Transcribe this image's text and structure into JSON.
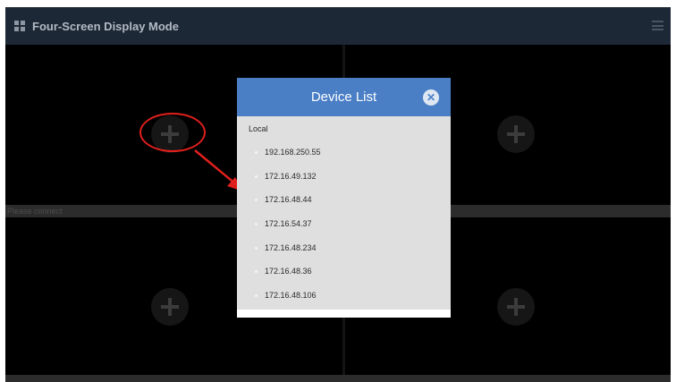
{
  "titlebar": {
    "title": "Four-Screen Display Mode",
    "grid_icon": "grid-icon",
    "menu_icon": "hamburger-menu-icon",
    "background": "#1d2836"
  },
  "panes": [
    {
      "id": "top-left",
      "action_icon": "plus-icon"
    },
    {
      "id": "top-right",
      "action_icon": "plus-icon"
    },
    {
      "id": "bottom-left",
      "action_icon": "plus-icon"
    },
    {
      "id": "bottom-right",
      "action_icon": "plus-icon"
    }
  ],
  "status_strip": {
    "label": "Please connect"
  },
  "annotation": {
    "color": "#e0201c",
    "shapes": [
      "ellipse",
      "arrow"
    ]
  },
  "device_list": {
    "title": "Device List",
    "close_icon": "close-icon",
    "header_color": "#4a7fc6",
    "group": "Local",
    "devices": [
      "192.168.250.55",
      "172.16.49.132",
      "172.16.48.44",
      "172.16.54.37",
      "172.16.48.234",
      "172.16.48.36",
      "172.16.48.106"
    ]
  }
}
